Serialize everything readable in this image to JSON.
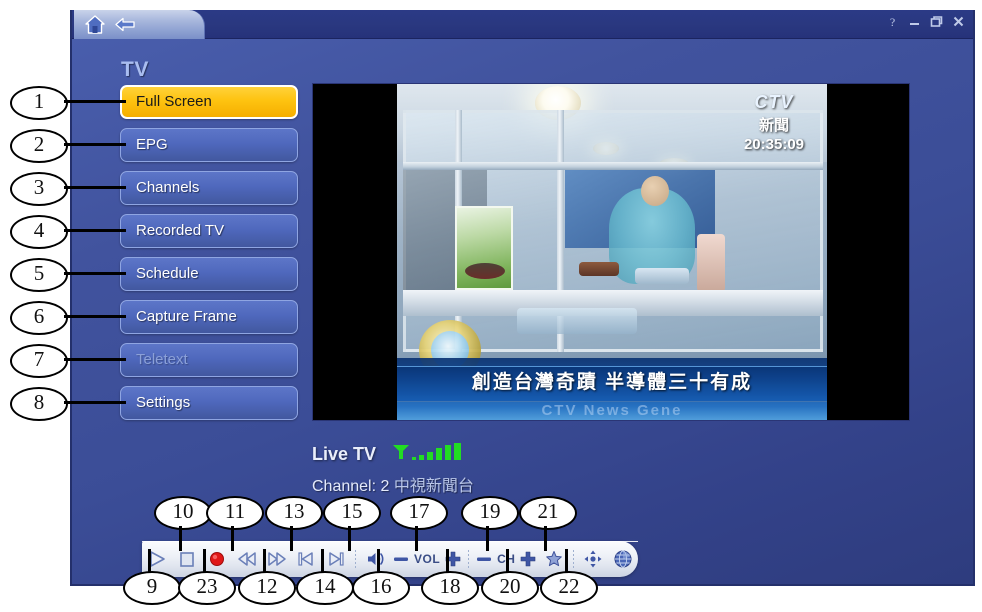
{
  "window": {
    "nav": {
      "home_icon": "home-icon",
      "back_icon": "back-arrow-icon"
    },
    "title_buttons": [
      {
        "name": "help-button",
        "glyph": "?"
      },
      {
        "name": "minimize-button",
        "glyph": "–"
      },
      {
        "name": "restore-button",
        "glyph": "❐"
      },
      {
        "name": "close-button",
        "glyph": "✕"
      }
    ]
  },
  "page": {
    "heading": "TV"
  },
  "sidebar": {
    "items": [
      {
        "label": "Full Screen",
        "state": "active"
      },
      {
        "label": "EPG",
        "state": "normal"
      },
      {
        "label": "Channels",
        "state": "normal"
      },
      {
        "label": "Recorded TV",
        "state": "normal"
      },
      {
        "label": "Schedule",
        "state": "normal"
      },
      {
        "label": "Capture Frame",
        "state": "normal"
      },
      {
        "label": "Teletext",
        "state": "disabled"
      },
      {
        "label": "Settings",
        "state": "normal"
      }
    ]
  },
  "video": {
    "broadcaster_logo": "CTV",
    "broadcaster_sub": "新聞",
    "timestamp": "20:35:09",
    "headline": "創造台灣奇蹟 半導體三十有成",
    "headline_sub": "CTV News Gene"
  },
  "status": {
    "mode": "Live TV",
    "signal_icon": "signal-strength-icon",
    "signal_bars": 6,
    "signal_color": "#22dd22",
    "channel_label": "Channel: 2",
    "channel_name": "中視新聞台"
  },
  "controls": [
    {
      "name": "play-button",
      "icon": "play-icon",
      "callout": "9"
    },
    {
      "name": "stop-button",
      "icon": "stop-icon",
      "callout": "10"
    },
    {
      "name": "record-button",
      "icon": "record-icon",
      "callout": "23"
    },
    {
      "name": "rewind-button",
      "icon": "rewind-icon",
      "callout": "11"
    },
    {
      "name": "fast-forward-button",
      "icon": "fast-forward-icon",
      "callout": "12"
    },
    {
      "name": "previous-button",
      "icon": "skip-previous-icon",
      "callout": "13"
    },
    {
      "name": "next-button",
      "icon": "skip-next-icon",
      "callout": "14"
    },
    {
      "name": "mute-button",
      "icon": "speaker-icon",
      "callout": "15"
    },
    {
      "name": "volume-down-button",
      "icon": "minus-icon",
      "callout": "16"
    },
    {
      "name": "volume-label",
      "icon": "text",
      "label": "VOL"
    },
    {
      "name": "volume-up-button",
      "icon": "plus-icon",
      "callout": "17"
    },
    {
      "name": "channel-down-button",
      "icon": "minus-icon",
      "callout": "18"
    },
    {
      "name": "channel-label",
      "icon": "text",
      "label": "CH"
    },
    {
      "name": "channel-up-button",
      "icon": "plus-icon",
      "callout": "19"
    },
    {
      "name": "favorite-button",
      "icon": "star-icon",
      "callout": "20"
    },
    {
      "name": "resize-button",
      "icon": "move-resize-icon",
      "callout": "21"
    },
    {
      "name": "web-button",
      "icon": "globe-icon",
      "callout": "22"
    }
  ],
  "callouts": {
    "sidebar": [
      "1",
      "2",
      "3",
      "4",
      "5",
      "6",
      "7",
      "8"
    ],
    "top_row": [
      "10",
      "11",
      "13",
      "15",
      "17",
      "19",
      "21"
    ],
    "bottom_row": [
      "9",
      "23",
      "12",
      "14",
      "16",
      "18",
      "20",
      "22"
    ]
  },
  "colors": {
    "accent": "#fec310",
    "window_blue": "#41539e",
    "signal_green": "#22dd22",
    "control_icon": "#4a5f9e"
  }
}
